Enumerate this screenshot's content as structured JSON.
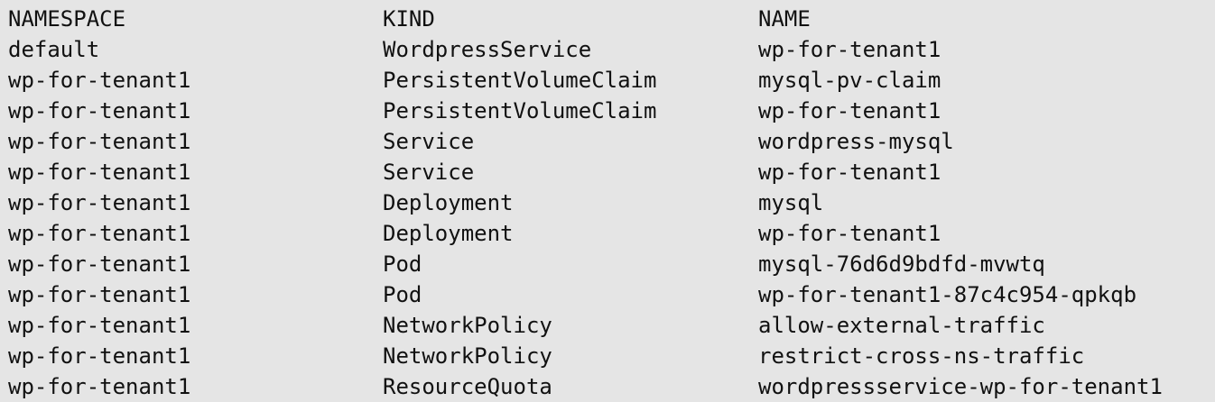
{
  "prompt_remnant": {
    "colors": [
      "#2fa52f",
      "#3b3bd6",
      "#111111"
    ]
  },
  "table": {
    "headers": {
      "namespace": "NAMESPACE",
      "kind": "KIND",
      "name": "NAME"
    },
    "rows": [
      {
        "namespace": "default",
        "kind": "WordpressService",
        "name": "wp-for-tenant1"
      },
      {
        "namespace": "wp-for-tenant1",
        "kind": "PersistentVolumeClaim",
        "name": "mysql-pv-claim"
      },
      {
        "namespace": "wp-for-tenant1",
        "kind": "PersistentVolumeClaim",
        "name": "wp-for-tenant1"
      },
      {
        "namespace": "wp-for-tenant1",
        "kind": "Service",
        "name": "wordpress-mysql"
      },
      {
        "namespace": "wp-for-tenant1",
        "kind": "Service",
        "name": "wp-for-tenant1"
      },
      {
        "namespace": "wp-for-tenant1",
        "kind": "Deployment",
        "name": "mysql"
      },
      {
        "namespace": "wp-for-tenant1",
        "kind": "Deployment",
        "name": "wp-for-tenant1"
      },
      {
        "namespace": "wp-for-tenant1",
        "kind": "Pod",
        "name": "mysql-76d6d9bdfd-mvwtq"
      },
      {
        "namespace": "wp-for-tenant1",
        "kind": "Pod",
        "name": "wp-for-tenant1-87c4c954-qpkqb"
      },
      {
        "namespace": "wp-for-tenant1",
        "kind": "NetworkPolicy",
        "name": "allow-external-traffic"
      },
      {
        "namespace": "wp-for-tenant1",
        "kind": "NetworkPolicy",
        "name": "restrict-cross-ns-traffic"
      },
      {
        "namespace": "wp-for-tenant1",
        "kind": "ResourceQuota",
        "name": "wordpressservice-wp-for-tenant1"
      }
    ]
  }
}
